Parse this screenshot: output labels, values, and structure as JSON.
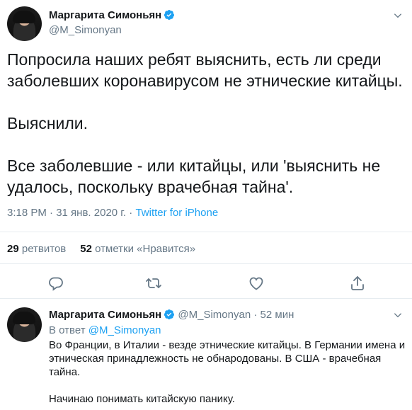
{
  "main_tweet": {
    "display_name": "Маргарита Симоньян",
    "handle": "@M_Simonyan",
    "text": [
      "Попросила наших ребят выяснить, есть ли среди заболевших коронавирусом не этнические китайцы.",
      "Выяснили.",
      "Все заболевшие - или китайцы, или 'выяснить не удалось, поскольку врачебная тайна'."
    ],
    "timestamp": "3:18 PM · 31 янв. 2020 г.",
    "meta_separator": " · ",
    "source": "Twitter for iPhone",
    "retweets_count": "29",
    "retweets_label": "ретвитов",
    "likes_count": "52",
    "likes_label": "отметки «Нравится»"
  },
  "reply_tweet": {
    "display_name": "Маргарита Симоньян",
    "handle": "@M_Simonyan",
    "dot": "·",
    "time": "52 мин",
    "reply_prefix": "В ответ",
    "reply_mention": "@M_Simonyan",
    "text": [
      "Во Франции, в Италии - везде этнические китайцы. В Германии имена и этническая принадлежность не обнародованы. В США - врачебная тайна.",
      "Начинаю понимать китайскую панику."
    ]
  },
  "icons": {
    "verified": "verified-badge-icon",
    "more": "chevron-down-icon",
    "reply": "reply-icon",
    "retweet": "retweet-icon",
    "like": "heart-icon",
    "share": "share-icon"
  },
  "colors": {
    "accent": "#1da1f2",
    "secondary_text": "#657786",
    "primary_text": "#14171a",
    "divider": "#e6ecf0"
  }
}
